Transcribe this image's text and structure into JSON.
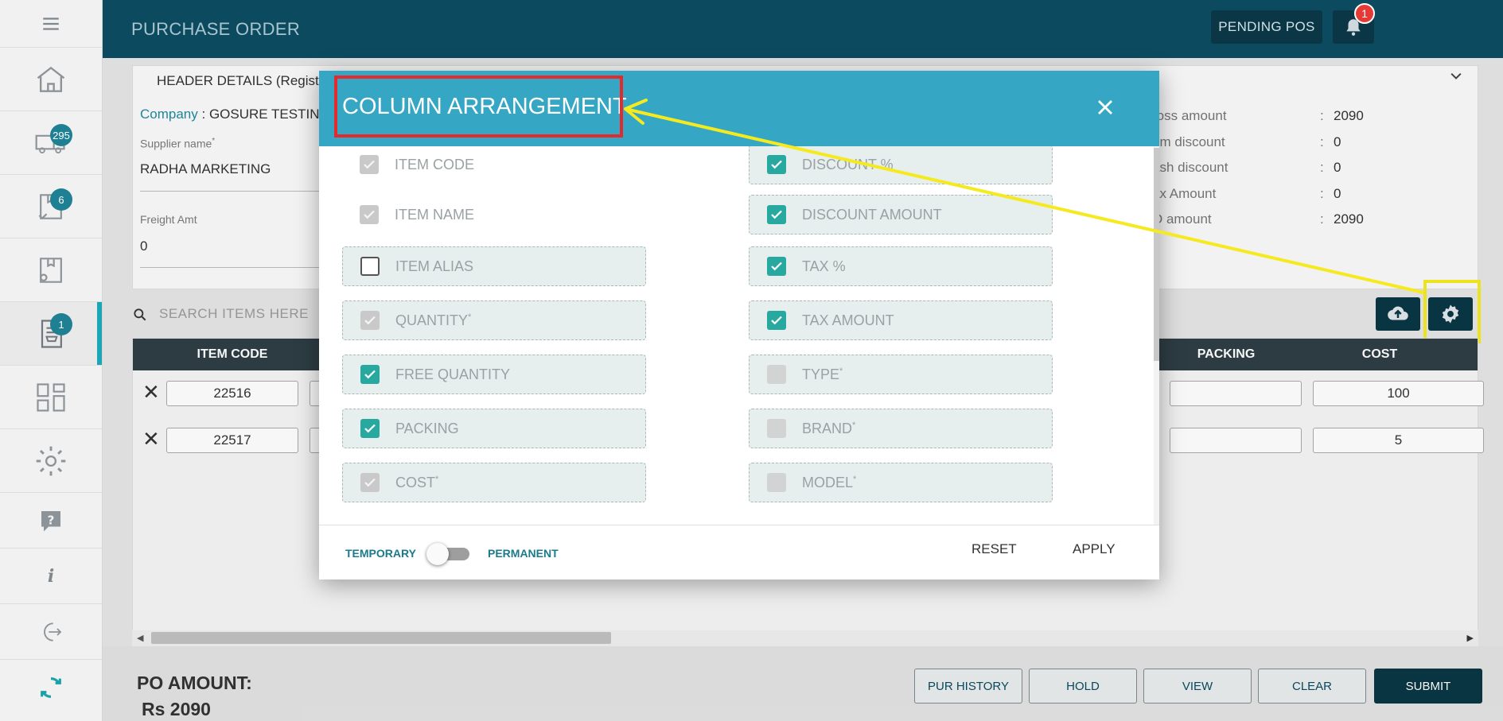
{
  "app": {
    "title": "PURCHASE ORDER",
    "pending_label": "PENDING POS",
    "notification_count": "1"
  },
  "sidebar": {
    "badges": {
      "orders": "295",
      "receipts": "6",
      "purchase": "1"
    },
    "info_glyph": "i"
  },
  "header": {
    "title": "HEADER DETAILS (Regist",
    "company_key": "Company",
    "company_sep": " : ",
    "company_value": "GOSURE TESTING",
    "supplier_label": "Supplier name",
    "supplier_req": "*",
    "supplier_value": "RADHA MARKETING",
    "freight_label": "Freight Amt",
    "freight_value": "0",
    "summary": [
      {
        "label": "ross amount",
        "value": "2090"
      },
      {
        "label": "em discount",
        "value": "0"
      },
      {
        "label": "ash discount",
        "value": "0"
      },
      {
        "label": "ax Amount",
        "value": "0"
      },
      {
        "label": "O amount",
        "value": "2090"
      }
    ],
    "summary_sep": ":"
  },
  "search": {
    "placeholder": "SEARCH ITEMS HERE"
  },
  "grid": {
    "headers": {
      "item_code": "ITEM CODE",
      "packing": "PACKING",
      "cost": "COST"
    },
    "rows": [
      {
        "item_code": "22516",
        "cost": "100"
      },
      {
        "item_code": "22517",
        "cost": "5"
      }
    ]
  },
  "footer": {
    "po_amount_label": "PO AMOUNT:",
    "po_amount_value": "Rs 2090",
    "buttons": {
      "history": "PUR HISTORY",
      "hold": "HOLD",
      "view": "VIEW",
      "clear": "CLEAR",
      "submit": "SUBMIT"
    }
  },
  "modal": {
    "title": "COLUMN ARRANGEMENT",
    "left": [
      {
        "label": "ITEM CODE",
        "state": "grey",
        "boxed": false,
        "req": ""
      },
      {
        "label": "ITEM NAME",
        "state": "grey",
        "boxed": false,
        "req": ""
      },
      {
        "label": "ITEM ALIAS",
        "state": "empty",
        "boxed": true,
        "req": ""
      },
      {
        "label": "QUANTITY",
        "state": "grey",
        "boxed": true,
        "req": "*"
      },
      {
        "label": "FREE QUANTITY",
        "state": "teal",
        "boxed": true,
        "req": ""
      },
      {
        "label": "PACKING",
        "state": "teal",
        "boxed": true,
        "req": ""
      },
      {
        "label": "COST",
        "state": "grey",
        "boxed": true,
        "req": "*"
      }
    ],
    "right": [
      {
        "label": "DISCOUNT %",
        "state": "teal",
        "boxed": true,
        "req": ""
      },
      {
        "label": "DISCOUNT AMOUNT",
        "state": "teal",
        "boxed": true,
        "req": ""
      },
      {
        "label": "TAX %",
        "state": "teal",
        "boxed": true,
        "req": ""
      },
      {
        "label": "TAX AMOUNT",
        "state": "teal",
        "boxed": true,
        "req": ""
      },
      {
        "label": "TYPE",
        "state": "dis",
        "boxed": true,
        "req": "*"
      },
      {
        "label": "BRAND",
        "state": "dis",
        "boxed": true,
        "req": "*"
      },
      {
        "label": "MODEL",
        "state": "dis",
        "boxed": true,
        "req": "*"
      }
    ],
    "temporary_label": "TEMPORARY",
    "permanent_label": "PERMANENT",
    "reset_label": "RESET",
    "apply_label": "APPLY"
  },
  "colors": {
    "topbar": "#0c4a5f",
    "modal_header": "#35a7c4",
    "checkbox_teal": "#27a9a0",
    "highlight_red": "#e42a2a",
    "highlight_yellow": "#f5ea1f"
  }
}
